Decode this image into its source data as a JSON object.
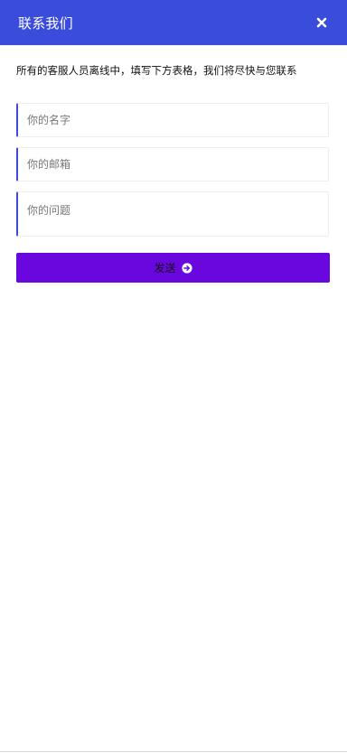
{
  "header": {
    "title": "联系我们",
    "close_icon": "close-icon"
  },
  "intro": {
    "text": "所有的客服人员离线中，填写下方表格，我们将尽快与您联系"
  },
  "form": {
    "name_placeholder": "你的名字",
    "email_placeholder": "你的邮箱",
    "question_placeholder": "你的问题",
    "send_label": "发送",
    "send_icon": "arrow-circle-right-icon"
  },
  "colors": {
    "header_bg": "#3a4cdc",
    "accent_border": "#3a4cdc",
    "send_button_bg": "#6a07de"
  }
}
